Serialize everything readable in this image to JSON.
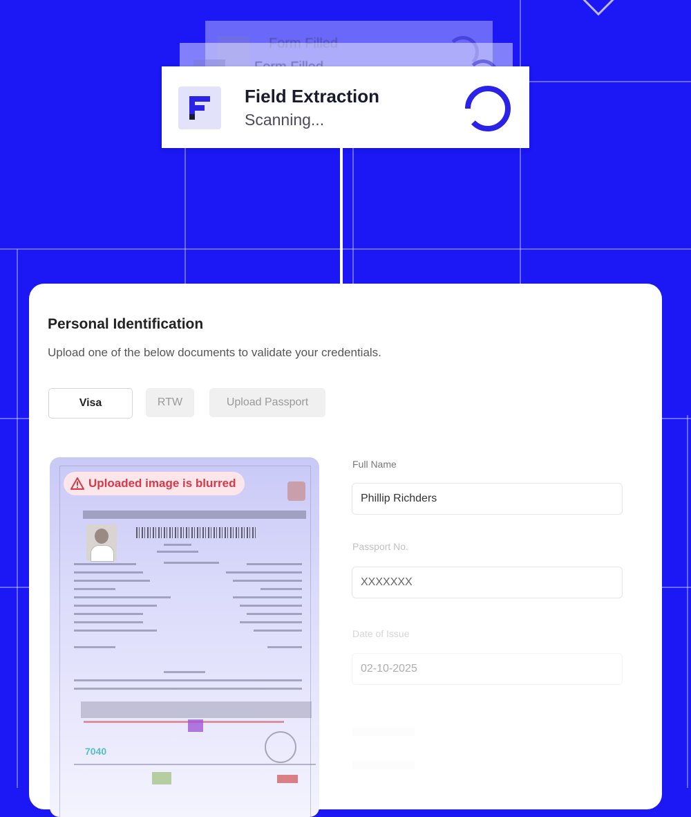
{
  "status_cards": {
    "ghost_back": {
      "title": "Form Filled"
    },
    "ghost_mid": {
      "title": "Form Filled"
    },
    "active": {
      "title": "Field Extraction",
      "status": "Scanning..."
    }
  },
  "panel": {
    "title": "Personal Identification",
    "subtitle": "Upload one of the below documents to validate your credentials.",
    "tabs": [
      {
        "label": "Visa",
        "active": true
      },
      {
        "label": "RTW",
        "active": false
      },
      {
        "label": "Upload Passport",
        "active": false
      }
    ],
    "document": {
      "warning": "Uploaded image is blurred",
      "icon": "warning-triangle-icon",
      "logo_text": "7040"
    },
    "fields": [
      {
        "label": "Full Name",
        "value": "Phillip Richders"
      },
      {
        "label": "Passport No.",
        "value": "XXXXXXX"
      },
      {
        "label": "Date of Issue",
        "value": "02-10-2025"
      }
    ]
  },
  "colors": {
    "background": "#1b17f5",
    "accent": "#2a22e6",
    "warning": "#d43a4a"
  }
}
